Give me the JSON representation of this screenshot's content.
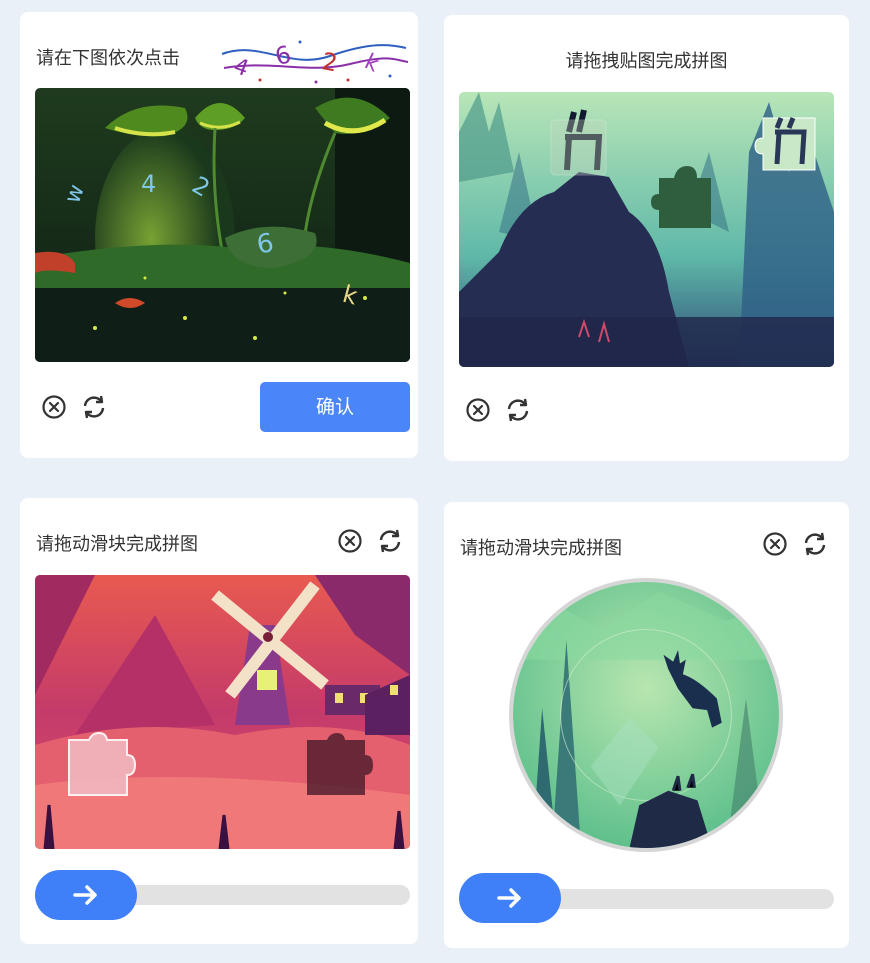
{
  "click_captcha": {
    "instruction": "请在下图依次点击",
    "code_chars": [
      "4",
      "6",
      "2",
      "k"
    ],
    "scene_chars": [
      "w",
      "4",
      "2",
      "6",
      "k"
    ],
    "confirm_label": "确认",
    "close_icon": "close-circle-icon",
    "refresh_icon": "refresh-icon"
  },
  "paste_captcha": {
    "instruction": "请拖拽贴图完成拼图"
  },
  "slider_captcha": {
    "instruction": "请拖动滑块完成拼图",
    "slider_progress": 0
  },
  "rotate_captcha": {
    "instruction": "请拖动滑块完成拼图",
    "slider_progress": 0
  },
  "colors": {
    "accent": "#3f7ff7",
    "confirm_bg": "#4b86f8",
    "page_bg": "#e9f0f8"
  }
}
